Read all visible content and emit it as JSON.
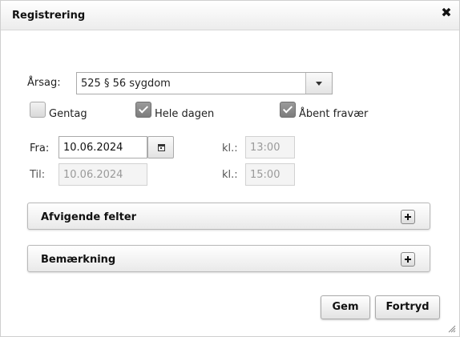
{
  "window": {
    "title": "Registrering"
  },
  "form": {
    "reason_label": "Årsag:",
    "reason_value": "525 § 56 sygdom",
    "checkboxes": [
      {
        "label": "Gentag",
        "checked": false
      },
      {
        "label": "Hele dagen",
        "checked": true
      },
      {
        "label": "Åbent fravær",
        "checked": true
      }
    ],
    "from_label": "Fra:",
    "from_date": "10.06.2024",
    "to_label": "Til:",
    "to_date": "10.06.2024",
    "time_label_from": "kl.:",
    "time_from": "13:00",
    "time_label_to": "kl.:",
    "time_to": "15:00"
  },
  "panels": [
    {
      "title": "Afvigende felter"
    },
    {
      "title": "Bemærkning"
    }
  ],
  "buttons": {
    "save": "Gem",
    "cancel": "Fortryd"
  },
  "icons": {
    "close": "close-icon",
    "dropdown": "chevron-down-icon",
    "calendar": "calendar-icon",
    "expand": "plus-icon",
    "resize": "resize-grip-icon"
  }
}
